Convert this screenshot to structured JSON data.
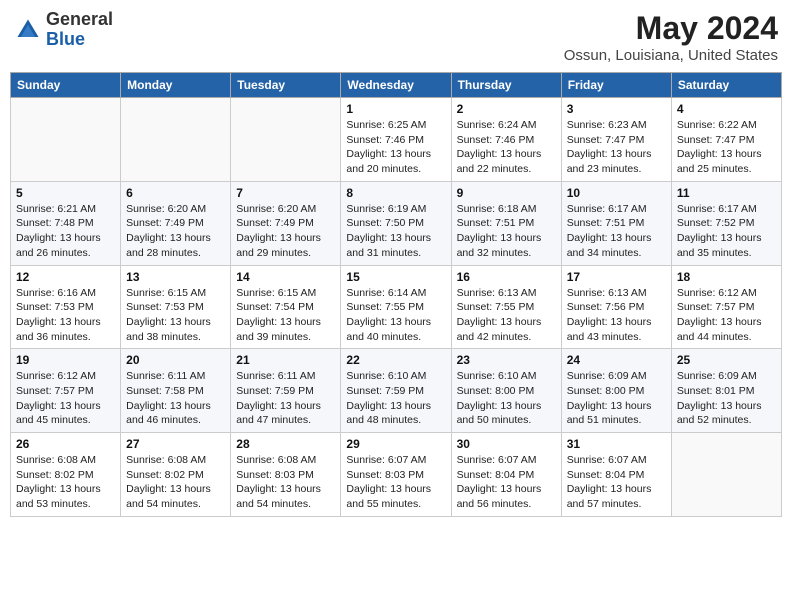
{
  "header": {
    "logo_general": "General",
    "logo_blue": "Blue",
    "month_year": "May 2024",
    "location": "Ossun, Louisiana, United States"
  },
  "weekdays": [
    "Sunday",
    "Monday",
    "Tuesday",
    "Wednesday",
    "Thursday",
    "Friday",
    "Saturday"
  ],
  "weeks": [
    [
      {
        "day": "",
        "info": ""
      },
      {
        "day": "",
        "info": ""
      },
      {
        "day": "",
        "info": ""
      },
      {
        "day": "1",
        "info": "Sunrise: 6:25 AM\nSunset: 7:46 PM\nDaylight: 13 hours\nand 20 minutes."
      },
      {
        "day": "2",
        "info": "Sunrise: 6:24 AM\nSunset: 7:46 PM\nDaylight: 13 hours\nand 22 minutes."
      },
      {
        "day": "3",
        "info": "Sunrise: 6:23 AM\nSunset: 7:47 PM\nDaylight: 13 hours\nand 23 minutes."
      },
      {
        "day": "4",
        "info": "Sunrise: 6:22 AM\nSunset: 7:47 PM\nDaylight: 13 hours\nand 25 minutes."
      }
    ],
    [
      {
        "day": "5",
        "info": "Sunrise: 6:21 AM\nSunset: 7:48 PM\nDaylight: 13 hours\nand 26 minutes."
      },
      {
        "day": "6",
        "info": "Sunrise: 6:20 AM\nSunset: 7:49 PM\nDaylight: 13 hours\nand 28 minutes."
      },
      {
        "day": "7",
        "info": "Sunrise: 6:20 AM\nSunset: 7:49 PM\nDaylight: 13 hours\nand 29 minutes."
      },
      {
        "day": "8",
        "info": "Sunrise: 6:19 AM\nSunset: 7:50 PM\nDaylight: 13 hours\nand 31 minutes."
      },
      {
        "day": "9",
        "info": "Sunrise: 6:18 AM\nSunset: 7:51 PM\nDaylight: 13 hours\nand 32 minutes."
      },
      {
        "day": "10",
        "info": "Sunrise: 6:17 AM\nSunset: 7:51 PM\nDaylight: 13 hours\nand 34 minutes."
      },
      {
        "day": "11",
        "info": "Sunrise: 6:17 AM\nSunset: 7:52 PM\nDaylight: 13 hours\nand 35 minutes."
      }
    ],
    [
      {
        "day": "12",
        "info": "Sunrise: 6:16 AM\nSunset: 7:53 PM\nDaylight: 13 hours\nand 36 minutes."
      },
      {
        "day": "13",
        "info": "Sunrise: 6:15 AM\nSunset: 7:53 PM\nDaylight: 13 hours\nand 38 minutes."
      },
      {
        "day": "14",
        "info": "Sunrise: 6:15 AM\nSunset: 7:54 PM\nDaylight: 13 hours\nand 39 minutes."
      },
      {
        "day": "15",
        "info": "Sunrise: 6:14 AM\nSunset: 7:55 PM\nDaylight: 13 hours\nand 40 minutes."
      },
      {
        "day": "16",
        "info": "Sunrise: 6:13 AM\nSunset: 7:55 PM\nDaylight: 13 hours\nand 42 minutes."
      },
      {
        "day": "17",
        "info": "Sunrise: 6:13 AM\nSunset: 7:56 PM\nDaylight: 13 hours\nand 43 minutes."
      },
      {
        "day": "18",
        "info": "Sunrise: 6:12 AM\nSunset: 7:57 PM\nDaylight: 13 hours\nand 44 minutes."
      }
    ],
    [
      {
        "day": "19",
        "info": "Sunrise: 6:12 AM\nSunset: 7:57 PM\nDaylight: 13 hours\nand 45 minutes."
      },
      {
        "day": "20",
        "info": "Sunrise: 6:11 AM\nSunset: 7:58 PM\nDaylight: 13 hours\nand 46 minutes."
      },
      {
        "day": "21",
        "info": "Sunrise: 6:11 AM\nSunset: 7:59 PM\nDaylight: 13 hours\nand 47 minutes."
      },
      {
        "day": "22",
        "info": "Sunrise: 6:10 AM\nSunset: 7:59 PM\nDaylight: 13 hours\nand 48 minutes."
      },
      {
        "day": "23",
        "info": "Sunrise: 6:10 AM\nSunset: 8:00 PM\nDaylight: 13 hours\nand 50 minutes."
      },
      {
        "day": "24",
        "info": "Sunrise: 6:09 AM\nSunset: 8:00 PM\nDaylight: 13 hours\nand 51 minutes."
      },
      {
        "day": "25",
        "info": "Sunrise: 6:09 AM\nSunset: 8:01 PM\nDaylight: 13 hours\nand 52 minutes."
      }
    ],
    [
      {
        "day": "26",
        "info": "Sunrise: 6:08 AM\nSunset: 8:02 PM\nDaylight: 13 hours\nand 53 minutes."
      },
      {
        "day": "27",
        "info": "Sunrise: 6:08 AM\nSunset: 8:02 PM\nDaylight: 13 hours\nand 54 minutes."
      },
      {
        "day": "28",
        "info": "Sunrise: 6:08 AM\nSunset: 8:03 PM\nDaylight: 13 hours\nand 54 minutes."
      },
      {
        "day": "29",
        "info": "Sunrise: 6:07 AM\nSunset: 8:03 PM\nDaylight: 13 hours\nand 55 minutes."
      },
      {
        "day": "30",
        "info": "Sunrise: 6:07 AM\nSunset: 8:04 PM\nDaylight: 13 hours\nand 56 minutes."
      },
      {
        "day": "31",
        "info": "Sunrise: 6:07 AM\nSunset: 8:04 PM\nDaylight: 13 hours\nand 57 minutes."
      },
      {
        "day": "",
        "info": ""
      }
    ]
  ]
}
